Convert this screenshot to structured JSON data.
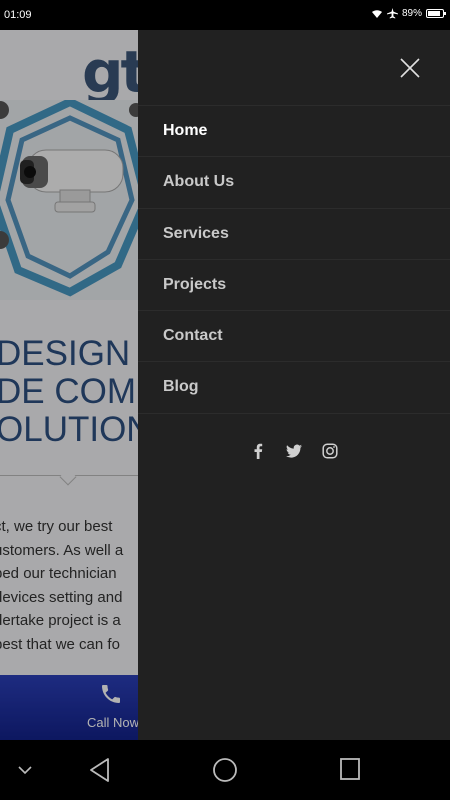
{
  "status_bar": {
    "time": "01:09",
    "battery_text": "89%",
    "battery_level": 0.89
  },
  "page": {
    "headline_lines": [
      "DESIGN A",
      "DE COM",
      "OLUTION"
    ],
    "paragraph_lines": [
      "ct, we try our best",
      "ustomers. As well a",
      "ped our technician",
      "devices setting and",
      "dertake project is a",
      "best that we can fo"
    ],
    "call_label": "Call Now"
  },
  "drawer": {
    "menu": [
      {
        "label": "Home",
        "active": true
      },
      {
        "label": "About Us",
        "active": false
      },
      {
        "label": "Services",
        "active": false
      },
      {
        "label": "Projects",
        "active": false
      },
      {
        "label": "Contact",
        "active": false
      },
      {
        "label": "Blog",
        "active": false
      }
    ],
    "social": [
      "facebook-icon",
      "twitter-icon",
      "instagram-icon"
    ]
  },
  "colors": {
    "drawer_bg": "#212121",
    "headline": "#2d4f80",
    "call_bar": "#1f31a8"
  }
}
